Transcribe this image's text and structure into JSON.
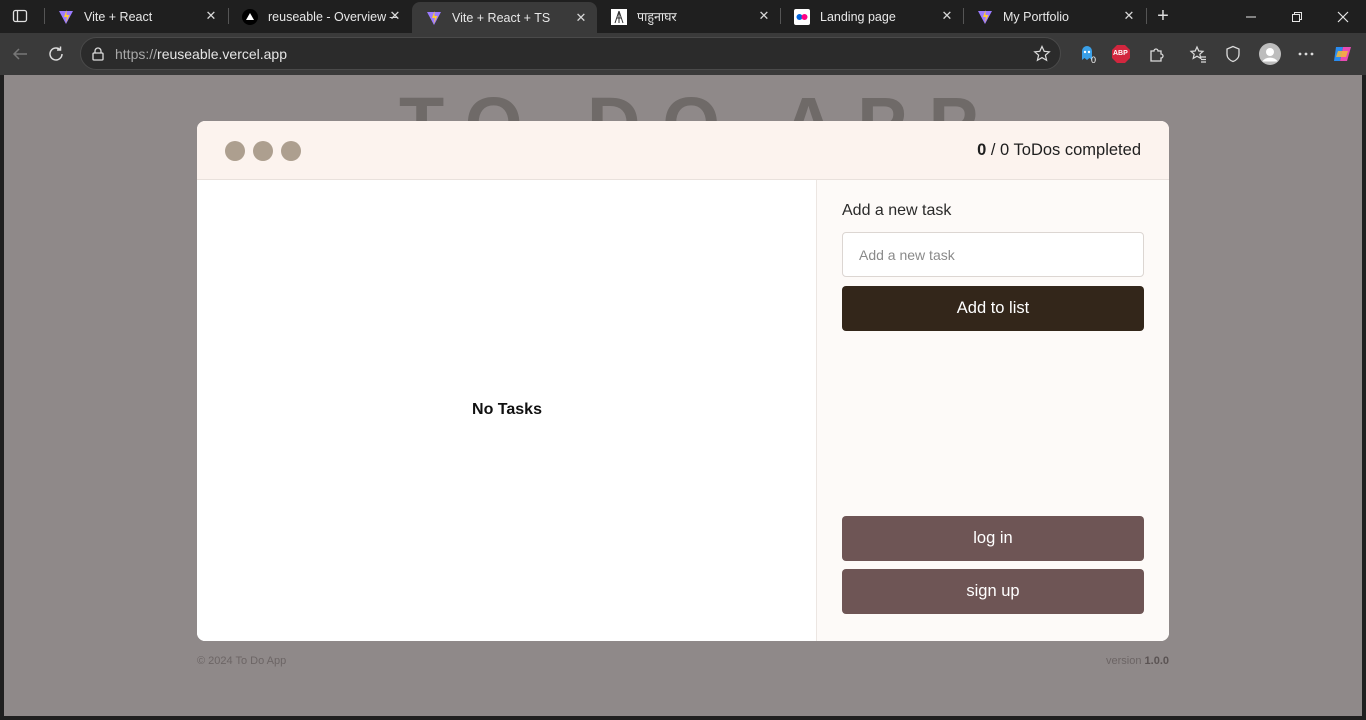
{
  "browser": {
    "tabs": [
      {
        "title": "Vite + React",
        "favicon": "vite-icon",
        "active": false
      },
      {
        "title": "reuseable - Overview –",
        "favicon": "vercel-icon",
        "active": false
      },
      {
        "title": "Vite + React + TS",
        "favicon": "vite-icon",
        "active": true
      },
      {
        "title": "पाहुनाघर",
        "favicon": "site-icon",
        "active": false
      },
      {
        "title": "Landing page",
        "favicon": "flickr-icon",
        "active": false
      },
      {
        "title": "My Portfolio",
        "favicon": "vite-icon",
        "active": false
      }
    ],
    "url_scheme": "https://",
    "url_host": "reuseable.vercel.app",
    "extension_badge": "0",
    "abp_label": "ABP"
  },
  "page": {
    "background_title": "TO DO APP",
    "header": {
      "completed_count": "0",
      "completed_rest": " / 0 ToDos completed"
    },
    "tasks": {
      "empty_message": "No Tasks"
    },
    "side": {
      "label": "Add a new task",
      "input_placeholder": "Add a new task",
      "input_value": "",
      "add_button": "Add to list",
      "login_button": "log in",
      "signup_button": "sign up"
    },
    "footer": {
      "copyright": "© 2024 To Do App",
      "version_label": "version ",
      "version_number": "1.0.0"
    },
    "colors": {
      "page_bg": "#8f8989",
      "header_bg": "#fcf3ee",
      "add_button": "#33261a",
      "auth_button": "#6e5555",
      "window_dot": "#ad9f8f"
    }
  }
}
